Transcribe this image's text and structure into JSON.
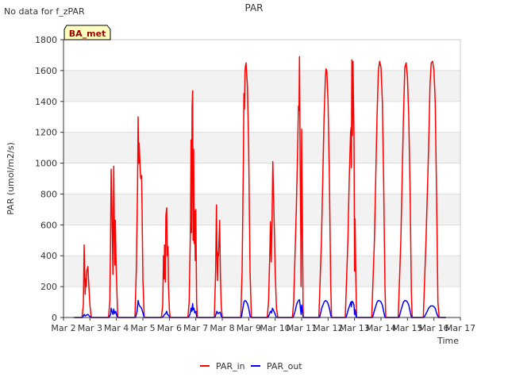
{
  "note": "No data for f_zPAR",
  "tag": "BA_met",
  "chart_data": {
    "type": "line",
    "title": "PAR",
    "xlabel": "Time",
    "ylabel": "PAR (umol/m2/s)",
    "ylim": [
      0,
      1800
    ],
    "xlim": [
      2,
      17
    ],
    "yticks": [
      0,
      200,
      400,
      600,
      800,
      1000,
      1200,
      1400,
      1600,
      1800
    ],
    "xticks": [
      {
        "v": 2,
        "label": "Mar 2"
      },
      {
        "v": 3,
        "label": "Mar 3"
      },
      {
        "v": 4,
        "label": "Mar 4"
      },
      {
        "v": 5,
        "label": "Mar 5"
      },
      {
        "v": 6,
        "label": "Mar 6"
      },
      {
        "v": 7,
        "label": "Mar 7"
      },
      {
        "v": 8,
        "label": "Mar 8"
      },
      {
        "v": 9,
        "label": "Mar 9"
      },
      {
        "v": 10,
        "label": "Mar 10"
      },
      {
        "v": 11,
        "label": "Mar 11"
      },
      {
        "v": 12,
        "label": "Mar 12"
      },
      {
        "v": 13,
        "label": "Mar 13"
      },
      {
        "v": 14,
        "label": "Mar 14"
      },
      {
        "v": 15,
        "label": "Mar 15"
      },
      {
        "v": 16,
        "label": "Mar 16"
      },
      {
        "v": 17,
        "label": "Mar 17"
      }
    ],
    "grid": true,
    "legend": "bottom",
    "series": [
      {
        "name": "PAR_in",
        "color": "#ff0000",
        "points": [
          [
            2.4,
            0
          ],
          [
            2.7,
            0
          ],
          [
            2.75,
            80
          ],
          [
            2.78,
            470
          ],
          [
            2.8,
            300
          ],
          [
            2.82,
            150
          ],
          [
            2.84,
            250
          ],
          [
            2.86,
            200
          ],
          [
            2.88,
            300
          ],
          [
            2.92,
            330
          ],
          [
            2.96,
            200
          ],
          [
            3.0,
            80
          ],
          [
            3.05,
            0
          ],
          [
            3.7,
            0
          ],
          [
            3.75,
            100
          ],
          [
            3.78,
            500
          ],
          [
            3.8,
            960
          ],
          [
            3.83,
            700
          ],
          [
            3.87,
            280
          ],
          [
            3.9,
            980
          ],
          [
            3.92,
            600
          ],
          [
            3.94,
            340
          ],
          [
            3.96,
            630
          ],
          [
            3.99,
            340
          ],
          [
            4.05,
            0
          ],
          [
            4.7,
            0
          ],
          [
            4.75,
            300
          ],
          [
            4.8,
            850
          ],
          [
            4.82,
            1300
          ],
          [
            4.84,
            1000
          ],
          [
            4.86,
            1130
          ],
          [
            4.9,
            950
          ],
          [
            4.92,
            900
          ],
          [
            4.95,
            920
          ],
          [
            4.97,
            700
          ],
          [
            5.0,
            250
          ],
          [
            5.05,
            0
          ],
          [
            5.7,
            0
          ],
          [
            5.75,
            80
          ],
          [
            5.78,
            400
          ],
          [
            5.8,
            250
          ],
          [
            5.82,
            470
          ],
          [
            5.85,
            230
          ],
          [
            5.87,
            660
          ],
          [
            5.9,
            710
          ],
          [
            5.92,
            400
          ],
          [
            5.95,
            460
          ],
          [
            5.97,
            200
          ],
          [
            6.0,
            60
          ],
          [
            6.03,
            0
          ],
          [
            6.7,
            0
          ],
          [
            6.75,
            100
          ],
          [
            6.8,
            600
          ],
          [
            6.82,
            1150
          ],
          [
            6.84,
            550
          ],
          [
            6.86,
            1360
          ],
          [
            6.88,
            1470
          ],
          [
            6.9,
            500
          ],
          [
            6.92,
            1090
          ],
          [
            6.94,
            480
          ],
          [
            6.96,
            690
          ],
          [
            6.98,
            370
          ],
          [
            7.0,
            700
          ],
          [
            7.03,
            100
          ],
          [
            7.06,
            0
          ],
          [
            7.7,
            0
          ],
          [
            7.75,
            300
          ],
          [
            7.78,
            730
          ],
          [
            7.8,
            450
          ],
          [
            7.82,
            240
          ],
          [
            7.84,
            420
          ],
          [
            7.86,
            400
          ],
          [
            7.9,
            630
          ],
          [
            7.93,
            270
          ],
          [
            7.96,
            80
          ],
          [
            8.0,
            0
          ],
          [
            8.7,
            0
          ],
          [
            8.75,
            300
          ],
          [
            8.8,
            1050
          ],
          [
            8.82,
            1450
          ],
          [
            8.84,
            1350
          ],
          [
            8.86,
            1600
          ],
          [
            8.88,
            1630
          ],
          [
            8.9,
            1650
          ],
          [
            8.95,
            1500
          ],
          [
            9.0,
            1100
          ],
          [
            9.05,
            300
          ],
          [
            9.1,
            0
          ],
          [
            9.7,
            0
          ],
          [
            9.75,
            100
          ],
          [
            9.8,
            430
          ],
          [
            9.82,
            620
          ],
          [
            9.85,
            360
          ],
          [
            9.88,
            620
          ],
          [
            9.91,
            1010
          ],
          [
            9.94,
            780
          ],
          [
            9.97,
            560
          ],
          [
            10.0,
            300
          ],
          [
            10.05,
            60
          ],
          [
            10.1,
            0
          ],
          [
            10.65,
            0
          ],
          [
            10.7,
            100
          ],
          [
            10.8,
            700
          ],
          [
            10.85,
            1100
          ],
          [
            10.88,
            1370
          ],
          [
            10.9,
            1340
          ],
          [
            10.92,
            1690
          ],
          [
            10.95,
            900
          ],
          [
            10.97,
            500
          ],
          [
            10.98,
            200
          ],
          [
            11.0,
            1220
          ],
          [
            11.03,
            600
          ],
          [
            11.06,
            0
          ],
          [
            11.65,
            0
          ],
          [
            11.75,
            500
          ],
          [
            11.85,
            1300
          ],
          [
            11.9,
            1560
          ],
          [
            11.92,
            1610
          ],
          [
            11.95,
            1600
          ],
          [
            12.0,
            1400
          ],
          [
            12.05,
            900
          ],
          [
            12.1,
            200
          ],
          [
            12.13,
            0
          ],
          [
            12.65,
            0
          ],
          [
            12.75,
            500
          ],
          [
            12.8,
            900
          ],
          [
            12.85,
            1200
          ],
          [
            12.87,
            1230
          ],
          [
            12.88,
            970
          ],
          [
            12.9,
            1670
          ],
          [
            12.92,
            1180
          ],
          [
            12.94,
            1660
          ],
          [
            12.96,
            1420
          ],
          [
            12.98,
            1180
          ],
          [
            13.0,
            300
          ],
          [
            13.02,
            640
          ],
          [
            13.05,
            250
          ],
          [
            13.08,
            0
          ],
          [
            13.65,
            0
          ],
          [
            13.75,
            500
          ],
          [
            13.85,
            1300
          ],
          [
            13.9,
            1600
          ],
          [
            13.95,
            1660
          ],
          [
            14.0,
            1620
          ],
          [
            14.05,
            1400
          ],
          [
            14.1,
            900
          ],
          [
            14.15,
            200
          ],
          [
            14.18,
            0
          ],
          [
            14.65,
            0
          ],
          [
            14.75,
            500
          ],
          [
            14.85,
            1300
          ],
          [
            14.9,
            1620
          ],
          [
            14.95,
            1650
          ],
          [
            15.0,
            1560
          ],
          [
            15.05,
            1300
          ],
          [
            15.1,
            800
          ],
          [
            15.15,
            150
          ],
          [
            15.18,
            0
          ],
          [
            15.6,
            0
          ],
          [
            15.7,
            500
          ],
          [
            15.8,
            1100
          ],
          [
            15.85,
            1500
          ],
          [
            15.9,
            1650
          ],
          [
            15.95,
            1660
          ],
          [
            16.0,
            1600
          ],
          [
            16.05,
            1400
          ],
          [
            16.1,
            800
          ],
          [
            16.15,
            100
          ],
          [
            16.2,
            0
          ],
          [
            16.45,
            0
          ]
        ]
      },
      {
        "name": "PAR_out",
        "color": "#0000ff",
        "points": [
          [
            2.4,
            0
          ],
          [
            2.72,
            0
          ],
          [
            2.78,
            20
          ],
          [
            2.82,
            10
          ],
          [
            2.86,
            15
          ],
          [
            2.92,
            20
          ],
          [
            2.98,
            10
          ],
          [
            3.05,
            0
          ],
          [
            3.72,
            0
          ],
          [
            3.78,
            20
          ],
          [
            3.8,
            60
          ],
          [
            3.83,
            40
          ],
          [
            3.87,
            20
          ],
          [
            3.9,
            55
          ],
          [
            3.93,
            25
          ],
          [
            3.97,
            40
          ],
          [
            4.02,
            10
          ],
          [
            4.06,
            0
          ],
          [
            4.72,
            0
          ],
          [
            4.78,
            40
          ],
          [
            4.82,
            110
          ],
          [
            4.86,
            80
          ],
          [
            4.9,
            70
          ],
          [
            4.95,
            60
          ],
          [
            5.0,
            30
          ],
          [
            5.05,
            0
          ],
          [
            5.72,
            0
          ],
          [
            5.78,
            10
          ],
          [
            5.82,
            20
          ],
          [
            5.86,
            25
          ],
          [
            5.9,
            40
          ],
          [
            5.93,
            20
          ],
          [
            5.97,
            15
          ],
          [
            6.02,
            0
          ],
          [
            6.72,
            0
          ],
          [
            6.78,
            20
          ],
          [
            6.82,
            60
          ],
          [
            6.85,
            40
          ],
          [
            6.88,
            90
          ],
          [
            6.9,
            50
          ],
          [
            6.93,
            60
          ],
          [
            6.96,
            30
          ],
          [
            7.0,
            40
          ],
          [
            7.04,
            0
          ],
          [
            7.72,
            0
          ],
          [
            7.76,
            20
          ],
          [
            7.8,
            40
          ],
          [
            7.84,
            25
          ],
          [
            7.88,
            30
          ],
          [
            7.92,
            35
          ],
          [
            7.96,
            10
          ],
          [
            8.0,
            0
          ],
          [
            8.72,
            0
          ],
          [
            8.78,
            60
          ],
          [
            8.82,
            100
          ],
          [
            8.86,
            110
          ],
          [
            8.9,
            105
          ],
          [
            8.95,
            90
          ],
          [
            9.0,
            60
          ],
          [
            9.05,
            10
          ],
          [
            9.1,
            0
          ],
          [
            9.72,
            0
          ],
          [
            9.78,
            20
          ],
          [
            9.82,
            40
          ],
          [
            9.86,
            30
          ],
          [
            9.9,
            60
          ],
          [
            9.94,
            45
          ],
          [
            9.98,
            30
          ],
          [
            10.05,
            0
          ],
          [
            10.68,
            0
          ],
          [
            10.75,
            40
          ],
          [
            10.82,
            90
          ],
          [
            10.88,
            110
          ],
          [
            10.92,
            115
          ],
          [
            10.95,
            70
          ],
          [
            10.98,
            20
          ],
          [
            11.0,
            80
          ],
          [
            11.03,
            40
          ],
          [
            11.06,
            0
          ],
          [
            11.68,
            0
          ],
          [
            11.76,
            60
          ],
          [
            11.85,
            100
          ],
          [
            11.9,
            110
          ],
          [
            11.95,
            105
          ],
          [
            12.0,
            90
          ],
          [
            12.05,
            60
          ],
          [
            12.1,
            15
          ],
          [
            12.13,
            0
          ],
          [
            12.68,
            0
          ],
          [
            12.76,
            50
          ],
          [
            12.82,
            80
          ],
          [
            12.86,
            100
          ],
          [
            12.88,
            70
          ],
          [
            12.9,
            105
          ],
          [
            12.94,
            100
          ],
          [
            12.98,
            80
          ],
          [
            13.0,
            20
          ],
          [
            13.02,
            50
          ],
          [
            13.06,
            0
          ],
          [
            13.68,
            0
          ],
          [
            13.76,
            50
          ],
          [
            13.85,
            100
          ],
          [
            13.9,
            110
          ],
          [
            13.95,
            108
          ],
          [
            14.0,
            100
          ],
          [
            14.05,
            80
          ],
          [
            14.1,
            40
          ],
          [
            14.15,
            0
          ],
          [
            14.68,
            0
          ],
          [
            14.76,
            50
          ],
          [
            14.85,
            100
          ],
          [
            14.9,
            110
          ],
          [
            14.95,
            108
          ],
          [
            15.0,
            100
          ],
          [
            15.05,
            80
          ],
          [
            15.1,
            40
          ],
          [
            15.15,
            0
          ],
          [
            15.62,
            0
          ],
          [
            15.72,
            30
          ],
          [
            15.8,
            60
          ],
          [
            15.88,
            75
          ],
          [
            15.95,
            75
          ],
          [
            16.0,
            70
          ],
          [
            16.05,
            60
          ],
          [
            16.1,
            30
          ],
          [
            16.17,
            0
          ],
          [
            16.45,
            0
          ]
        ]
      }
    ]
  }
}
